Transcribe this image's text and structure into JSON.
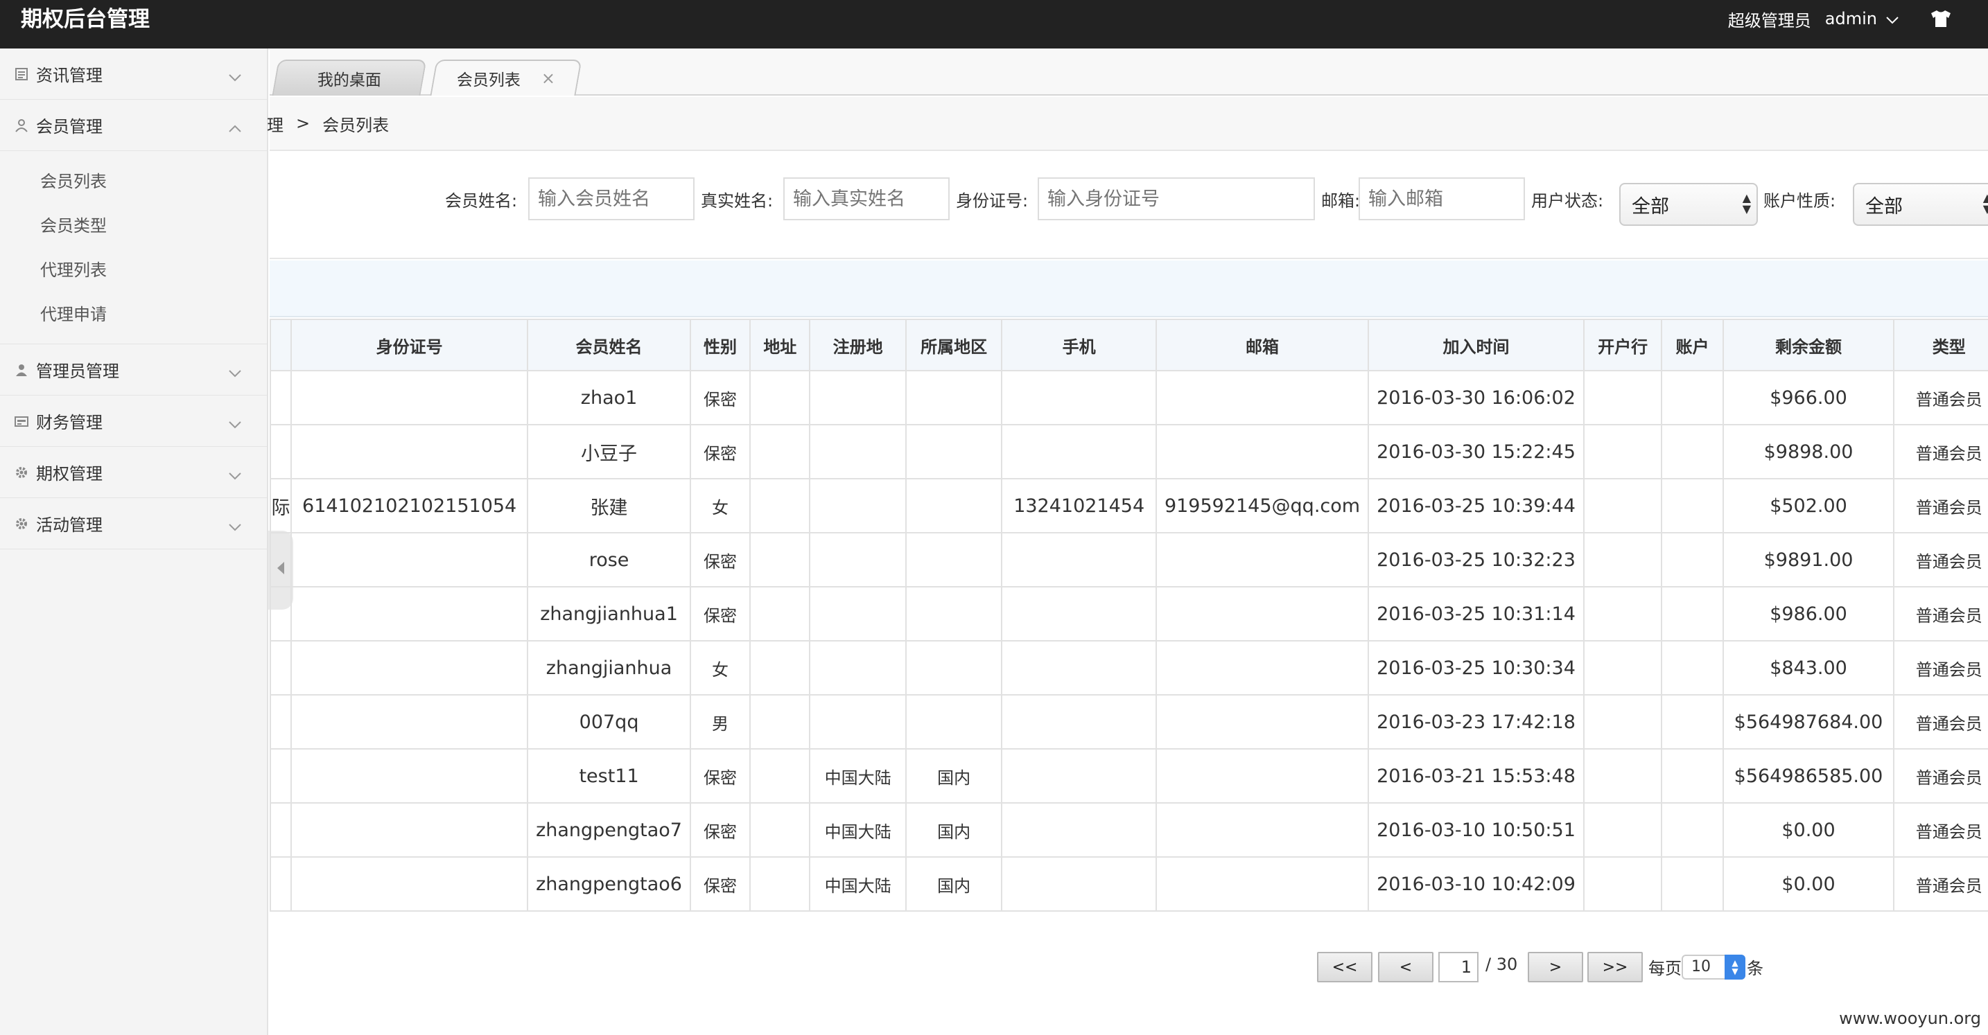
{
  "header": {
    "app_title": "期权后台管理",
    "role": "超级管理员",
    "username": "admin"
  },
  "sidebar": {
    "items": [
      {
        "label": "资讯管理",
        "icon": "news-icon",
        "expanded": false
      },
      {
        "label": "会员管理",
        "icon": "user-icon",
        "expanded": true,
        "children": [
          "会员列表",
          "会员类型",
          "代理列表",
          "代理申请"
        ]
      },
      {
        "label": "管理员管理",
        "icon": "admin-icon",
        "expanded": false
      },
      {
        "label": "财务管理",
        "icon": "finance-icon",
        "expanded": false
      },
      {
        "label": "期权管理",
        "icon": "gear-icon",
        "expanded": false
      },
      {
        "label": "活动管理",
        "icon": "gear-icon",
        "expanded": false
      }
    ]
  },
  "tabs": [
    {
      "label": "我的桌面",
      "active": false
    },
    {
      "label": "会员列表",
      "active": true,
      "close": "×"
    }
  ],
  "breadcrumb": {
    "prev": "理",
    "separator": ">",
    "current": "会员列表"
  },
  "search": {
    "member_name_label": "会员姓名:",
    "member_name_placeholder": "输入会员姓名",
    "real_name_label": "真实姓名:",
    "real_name_placeholder": "输入真实姓名",
    "id_label": "身份证号:",
    "id_placeholder": "输入身份证号",
    "email_label": "邮箱:",
    "email_placeholder": "输入邮箱",
    "status_label": "用户状态:",
    "status_value": "全部",
    "account_type_label": "账户性质:",
    "account_type_value": "全部"
  },
  "table": {
    "columns": [
      "",
      "身份证号",
      "会员姓名",
      "性别",
      "地址",
      "注册地",
      "所属地区",
      "手机",
      "邮箱",
      "加入时间",
      "开户行",
      "账户",
      "剩余金额",
      "类型"
    ],
    "rows": [
      [
        "",
        "",
        "zhao1",
        "保密",
        "",
        "",
        "",
        "",
        "",
        "2016-03-30 16:06:02",
        "",
        "",
        "$966.00",
        "普通会员"
      ],
      [
        "",
        "",
        "小豆子",
        "保密",
        "",
        "",
        "",
        "",
        "",
        "2016-03-30 15:22:45",
        "",
        "",
        "$9898.00",
        "普通会员"
      ],
      [
        "际",
        "614102102102151054",
        "张建",
        "女",
        "",
        "",
        "",
        "13241021454",
        "919592145@qq.com",
        "2016-03-25 10:39:44",
        "",
        "",
        "$502.00",
        "普通会员"
      ],
      [
        "",
        "",
        "rose",
        "保密",
        "",
        "",
        "",
        "",
        "",
        "2016-03-25 10:32:23",
        "",
        "",
        "$9891.00",
        "普通会员"
      ],
      [
        "",
        "",
        "zhangjianhua1",
        "保密",
        "",
        "",
        "",
        "",
        "",
        "2016-03-25 10:31:14",
        "",
        "",
        "$986.00",
        "普通会员"
      ],
      [
        "",
        "",
        "zhangjianhua",
        "女",
        "",
        "",
        "",
        "",
        "",
        "2016-03-25 10:30:34",
        "",
        "",
        "$843.00",
        "普通会员"
      ],
      [
        "",
        "",
        "007qq",
        "男",
        "",
        "",
        "",
        "",
        "",
        "2016-03-23 17:42:18",
        "",
        "",
        "$564987684.00",
        "普通会员"
      ],
      [
        "",
        "",
        "test11",
        "保密",
        "",
        "中国大陆",
        "国内",
        "",
        "",
        "2016-03-21 15:53:48",
        "",
        "",
        "$564986585.00",
        "普通会员"
      ],
      [
        "",
        "",
        "zhangpengtao7",
        "保密",
        "",
        "中国大陆",
        "国内",
        "",
        "",
        "2016-03-10 10:50:51",
        "",
        "",
        "$0.00",
        "普通会员"
      ],
      [
        "",
        "",
        "zhangpengtao6",
        "保密",
        "",
        "中国大陆",
        "国内",
        "",
        "",
        "2016-03-10 10:42:09",
        "",
        "",
        "$0.00",
        "普通会员"
      ]
    ]
  },
  "pager": {
    "first": "<<",
    "prev": "<",
    "current_page": "1",
    "total_pages": "/ 30",
    "next": ">",
    "last": ">>",
    "per_page_label": "每页",
    "per_page_value": "10",
    "per_page_unit": "条"
  },
  "watermark": "www.wooyun.org"
}
